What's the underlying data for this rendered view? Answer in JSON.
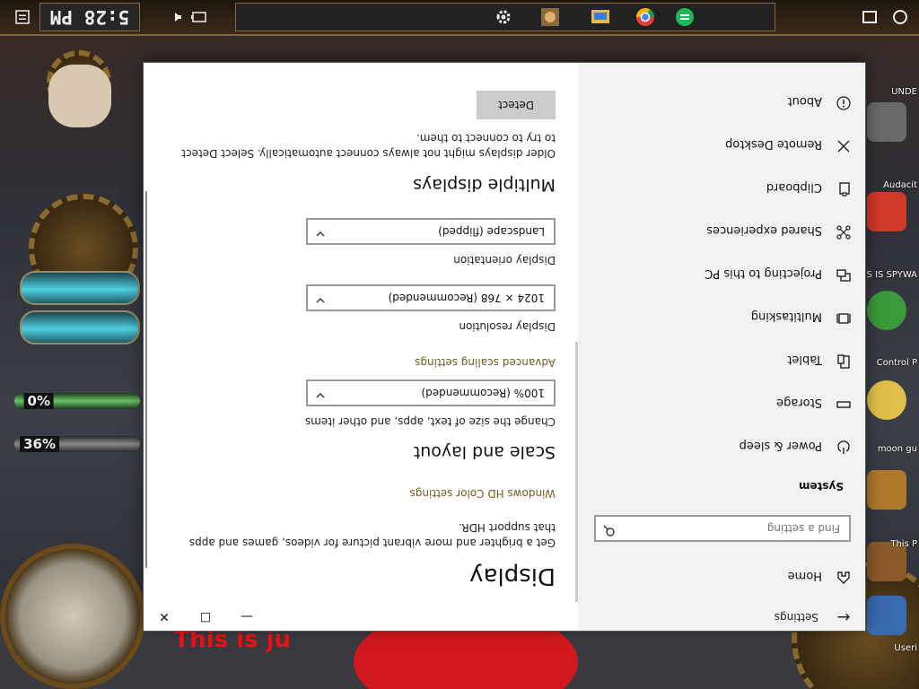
{
  "window": {
    "title": "Settings",
    "back_glyph": "←",
    "controls": {
      "minimize": "—",
      "maximize": "☐",
      "close": "✕"
    }
  },
  "sidebar": {
    "home": {
      "label": "Home",
      "icon": "home-icon"
    },
    "search": {
      "placeholder": "Find a setting",
      "icon": "search-icon"
    },
    "section": "System",
    "items": [
      {
        "label": "Power & sleep",
        "icon": "power-icon"
      },
      {
        "label": "Storage",
        "icon": "storage-icon"
      },
      {
        "label": "Tablet",
        "icon": "tablet-icon"
      },
      {
        "label": "Multitasking",
        "icon": "multitasking-icon"
      },
      {
        "label": "Projecting to this PC",
        "icon": "projecting-icon"
      },
      {
        "label": "Shared experiences",
        "icon": "shared-experiences-icon"
      },
      {
        "label": "Clipboard",
        "icon": "clipboard-icon"
      },
      {
        "label": "Remote Desktop",
        "icon": "remote-desktop-icon"
      },
      {
        "label": "About",
        "icon": "info-icon"
      }
    ]
  },
  "display": {
    "title": "Display",
    "hdr_text": "Get a brighter and more vibrant picture for videos, games and apps that support HDR.",
    "hdr_link": "Windows HD Color settings",
    "scale_heading": "Scale and layout",
    "scale_label": "Change the size of text, apps, and other items",
    "scale_value": "100% (Recommended)",
    "advanced_link": "Advanced scaling settings",
    "resolution_label": "Display resolution",
    "resolution_value": "1024 × 768 (Recommended)",
    "orientation_label": "Display orientation",
    "orientation_value": "Landscape (flipped)",
    "multiple_heading": "Multiple displays",
    "multiple_text": "Older displays might not always connect automatically. Select Detect to try to connect to them.",
    "detect_button": "Detect"
  },
  "taskbar": {
    "clock": "5:28 PM",
    "icons": [
      "settings-icon",
      "game-icon",
      "folder-icon",
      "chrome-icon",
      "notes-icon",
      "task-view-icon",
      "cortana-icon",
      "start-icon"
    ]
  },
  "desktop": {
    "gauge_values": [
      "0%",
      "36%"
    ],
    "text_overlay": "This is ju",
    "icon_labels": [
      "Useri",
      "This P",
      "moon gu",
      "Control P",
      "Audacit",
      "THIS IS SPYWA",
      "UNDE"
    ]
  },
  "colors": {
    "window_bg": "#ffffff",
    "sidebar_bg": "#f2f2f2",
    "link": "#735a1e",
    "button": "#cccccc",
    "taskbar": "#2a1d10"
  }
}
